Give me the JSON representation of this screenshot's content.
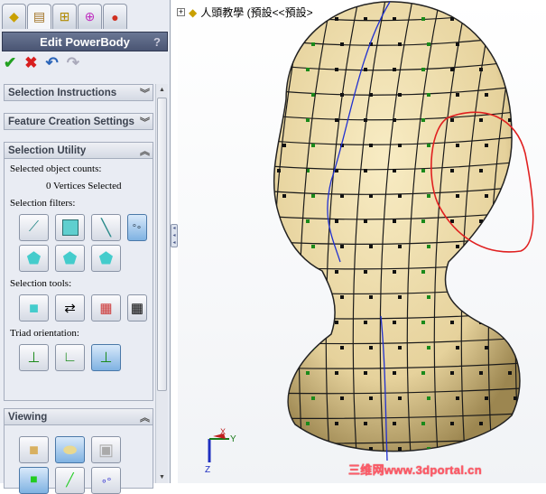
{
  "tabs": [
    {
      "name": "feature-manager"
    },
    {
      "name": "property-manager"
    },
    {
      "name": "configuration-manager"
    },
    {
      "name": "dimxpert-manager"
    },
    {
      "name": "display-manager"
    }
  ],
  "property_manager": {
    "title": "Edit PowerBody",
    "help": "?",
    "ok_icon": "check-icon",
    "cancel_icon": "x-icon",
    "undo_icon": "undo-icon",
    "redo_icon": "redo-icon"
  },
  "sections": {
    "selection_instructions": "Selection Instructions",
    "feature_creation": "Feature Creation Settings",
    "selection_utility": "Selection Utility",
    "viewing": "Viewing"
  },
  "selection_utility": {
    "counts_label": "Selected object counts:",
    "counts_value": "0 Vertices Selected",
    "filters_label": "Selection filters:",
    "tools_label": "Selection tools:",
    "triad_label": "Triad orientation:"
  },
  "tree": {
    "root": "人頭教學 (預設<<預設>"
  },
  "triad": {
    "x": "X",
    "y": "Y",
    "z": "Z"
  },
  "watermark": "三维网www.3dportal.cn",
  "colors": {
    "model": "#efe0b0",
    "mesh": "#1a1a1a",
    "annotation": "#e02020",
    "accent": "#4a5573"
  }
}
